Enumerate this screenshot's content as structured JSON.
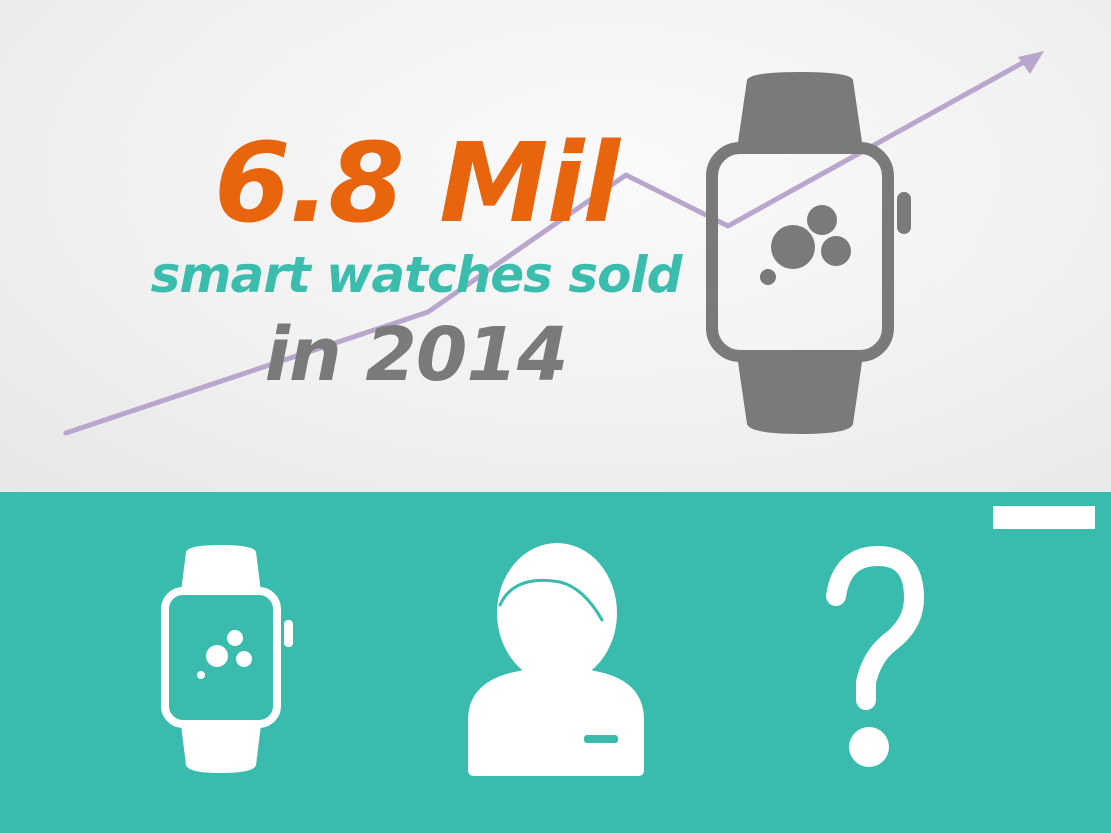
{
  "headline": {
    "amount": "6.8 Mil",
    "subtitle": "smart watches sold",
    "year": "in 2014"
  },
  "icons": {
    "hero": "smartwatch-icon",
    "trend": "trend-arrow-icon",
    "bottom": [
      "smartwatch-icon",
      "person-icon",
      "question-mark-icon"
    ],
    "bar": "minimize-bar-icon"
  },
  "colors": {
    "amount": "#e8650e",
    "subtitle": "#3bbdae",
    "year": "#7a7a7a",
    "watch": "#7a7a7a",
    "trend_line": "#b9a6cc",
    "band": "#39bcae",
    "band_icons": "#ffffff"
  }
}
